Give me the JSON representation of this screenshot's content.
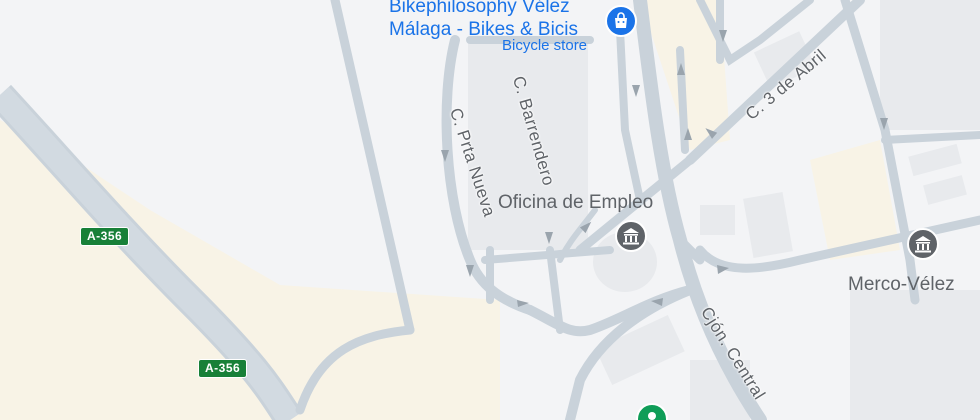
{
  "map": {
    "colors": {
      "land": "#f3f4f6",
      "road": "#c9d2da",
      "road_fill": "#d2dae1",
      "urban_block": "#e8eaed",
      "open_area": "#f8f3e6",
      "highway_shield": "#188038",
      "poi_blue": "#1a73e8",
      "poi_gray": "#5f6368",
      "poi_green": "#0f9d58"
    },
    "pois": {
      "bike_store": {
        "name_line1": "Bikephilosophy Vélez",
        "name_line2": "Málaga - Bikes & Bicis",
        "category": "Bicycle store",
        "icon": "shopping-bag-icon"
      },
      "employment_office": {
        "name": "Oficina de Empleo",
        "icon": "government-building-icon"
      },
      "market": {
        "name": "Merco-Vélez",
        "icon": "government-building-icon"
      },
      "green_poi": {
        "icon": "map-pin-green-icon"
      }
    },
    "streets": {
      "prta_nueva": "C. Prta Nueva",
      "barrendero": "C. Barrendero",
      "tres_de_abril": "C. 3 de Abril",
      "cjon_central": "Cjón. Central"
    },
    "highway_shields": {
      "upper": "A-356",
      "lower": "A-356"
    }
  }
}
